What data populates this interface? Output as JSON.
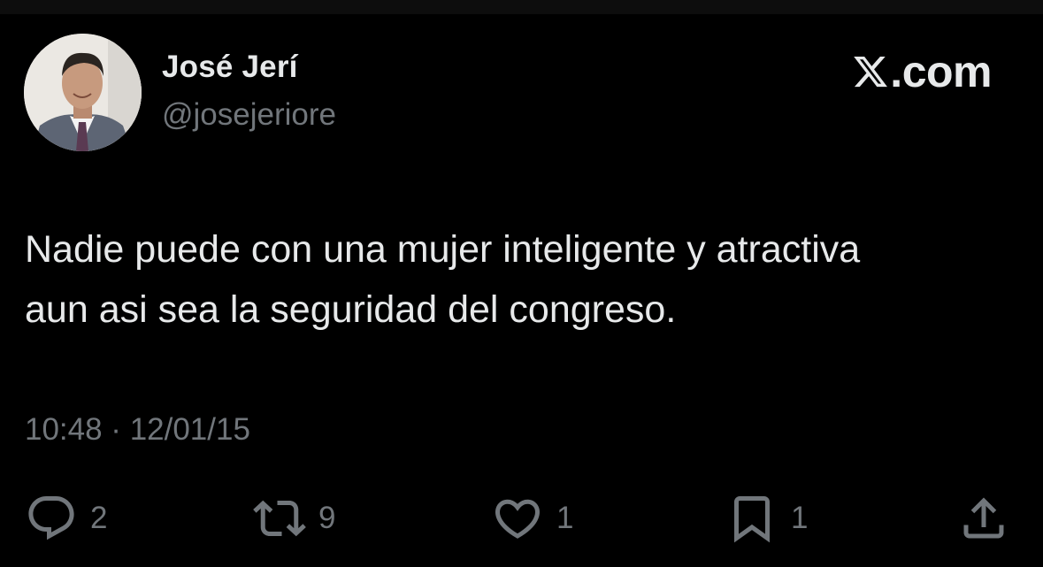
{
  "author": {
    "name": "José Jerí",
    "handle": "@josejeriore",
    "avatar_icon": "profile-photo"
  },
  "brand": {
    "text": ".com",
    "logo_icon": "x-logo-icon"
  },
  "tweet": {
    "text": "Nadie puede con una mujer inteligente y atractiva\naun asi sea la seguridad del congreso.",
    "timestamp": "10:48 · 12/01/15"
  },
  "actions": {
    "reply": {
      "icon": "reply-icon",
      "count": "2"
    },
    "retweet": {
      "icon": "retweet-icon",
      "count": "9"
    },
    "like": {
      "icon": "heart-icon",
      "count": "1"
    },
    "bookmark": {
      "icon": "bookmark-icon",
      "count": "1"
    },
    "share": {
      "icon": "share-icon"
    }
  },
  "colors": {
    "background": "#000000",
    "text_primary": "#e7e9ea",
    "text_secondary": "#71767b"
  }
}
